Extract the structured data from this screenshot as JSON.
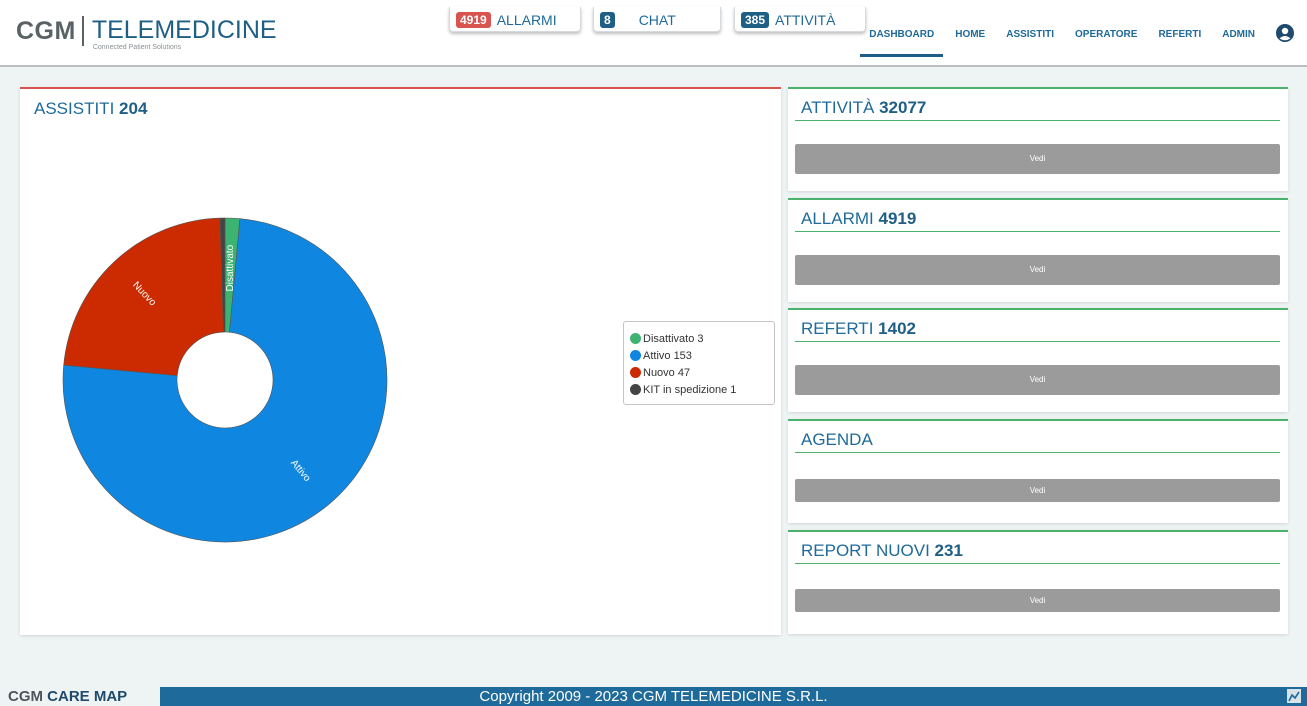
{
  "header": {
    "logo_left": "CGM",
    "logo_right": "TELEMEDICINE",
    "logo_sub": "Connected Patient Solutions",
    "counters": [
      {
        "badge": "4919",
        "label": "ALLARMI",
        "badge_color": "#d9534f"
      },
      {
        "badge": "8",
        "label": "CHAT",
        "badge_color": "#1f5f86"
      },
      {
        "badge": "385",
        "label": "ATTIVITÀ",
        "badge_color": "#1f5f86"
      }
    ],
    "nav": [
      "DASHBOARD",
      "HOME",
      "ASSISTITI",
      "OPERATORE",
      "REFERTI",
      "ADMIN"
    ],
    "active_nav": "DASHBOARD",
    "user_icon": "user-circle-icon"
  },
  "assistiti": {
    "title": "ASSISTITI",
    "count": "204"
  },
  "chart_data": {
    "type": "pie",
    "donut": true,
    "categories": [
      "Disattivato",
      "Attivo",
      "Nuovo",
      "KIT in spedizione"
    ],
    "values": [
      3,
      153,
      47,
      1
    ],
    "colors": [
      "#3cb371",
      "#0f87e0",
      "#cc2a00",
      "#444444"
    ],
    "slice_labels": [
      "Disattivato",
      "Attivo",
      "Nuovo",
      ""
    ],
    "legend": [
      "Disattivato 3",
      "Attivo 153",
      "Nuovo 47",
      "KIT in spedizione 1"
    ],
    "legend_position": "right"
  },
  "cards": [
    {
      "title": "ATTIVITÀ",
      "count": "32077",
      "button": "Vedi"
    },
    {
      "title": "ALLARMI",
      "count": "4919",
      "button": "Vedi"
    },
    {
      "title": "REFERTI",
      "count": "1402",
      "button": "Vedi"
    },
    {
      "title": "AGENDA",
      "count": "",
      "button": "Vedi"
    },
    {
      "title": "REPORT NUOVI",
      "count": "231",
      "button": "Vedi"
    }
  ],
  "footer": {
    "brand_left": "CGM",
    "brand_right": "CARE MAP",
    "copyright": "Copyright 2009 - 2023 CGM TELEMEDICINE S.R.L."
  },
  "colors": {
    "primary": "#1f6a99",
    "alarm": "#d9534f",
    "success": "#4bb26b",
    "footer": "#1e6a9a"
  }
}
